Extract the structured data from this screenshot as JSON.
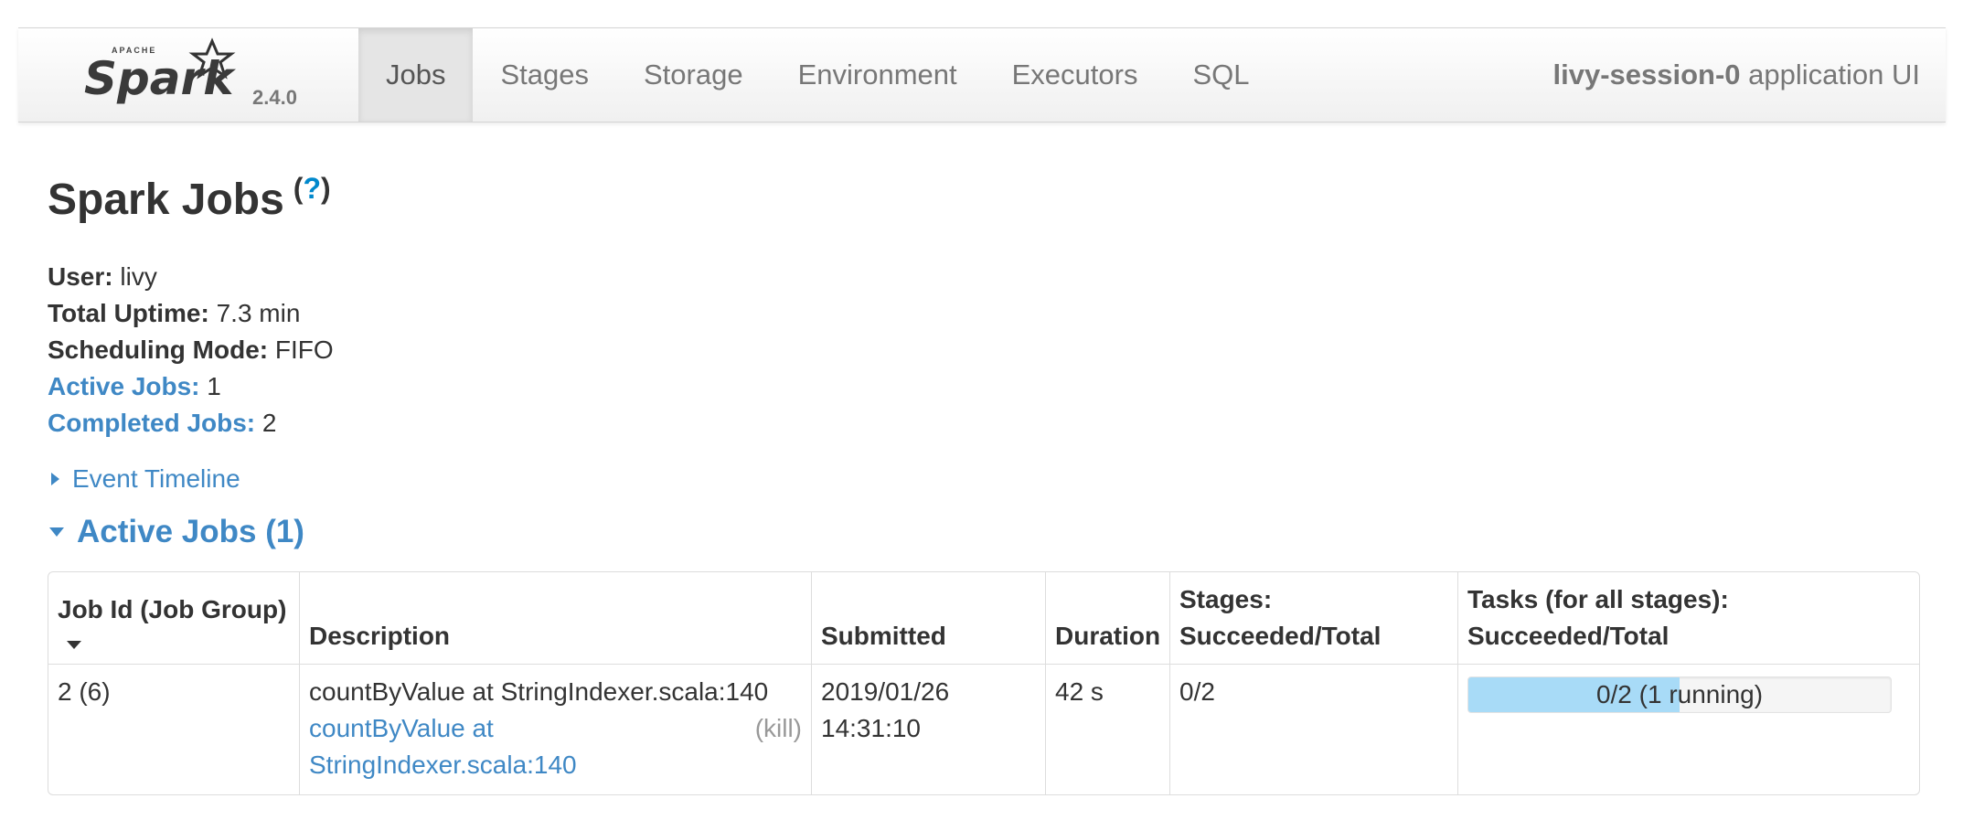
{
  "header": {
    "brand_version": "2.4.0",
    "tabs": [
      {
        "label": "Jobs"
      },
      {
        "label": "Stages"
      },
      {
        "label": "Storage"
      },
      {
        "label": "Environment"
      },
      {
        "label": "Executors"
      },
      {
        "label": "SQL"
      }
    ],
    "app_name": "livy-session-0",
    "app_suffix": "application UI"
  },
  "page": {
    "title": "Spark Jobs",
    "help_label": "?"
  },
  "summary": {
    "user_label": "User:",
    "user_value": "livy",
    "uptime_label": "Total Uptime:",
    "uptime_value": "7.3 min",
    "scheduling_label": "Scheduling Mode:",
    "scheduling_value": "FIFO",
    "active_label": "Active Jobs:",
    "active_value": "1",
    "completed_label": "Completed Jobs:",
    "completed_value": "2"
  },
  "event_timeline": "Event Timeline",
  "active_jobs": {
    "heading": "Active Jobs (1)",
    "columns": {
      "job_id": "Job Id (Job Group)",
      "description": "Description",
      "submitted": "Submitted",
      "duration": "Duration",
      "stages_1": "Stages:",
      "stages_2": "Succeeded/Total",
      "tasks_1": "Tasks (for all stages):",
      "tasks_2": "Succeeded/Total"
    },
    "rows": [
      {
        "job_id": "2 (6)",
        "description": "countByValue at StringIndexer.scala:140",
        "link_line1": "countByValue at",
        "link_line2": "StringIndexer.scala:140",
        "kill": "(kill)",
        "submitted_date": "2019/01/26",
        "submitted_time": "14:31:10",
        "duration": "42 s",
        "stages": "0/2",
        "tasks_label": "0/2 (1 running)",
        "tasks_running_fraction": 0.5
      }
    ]
  }
}
